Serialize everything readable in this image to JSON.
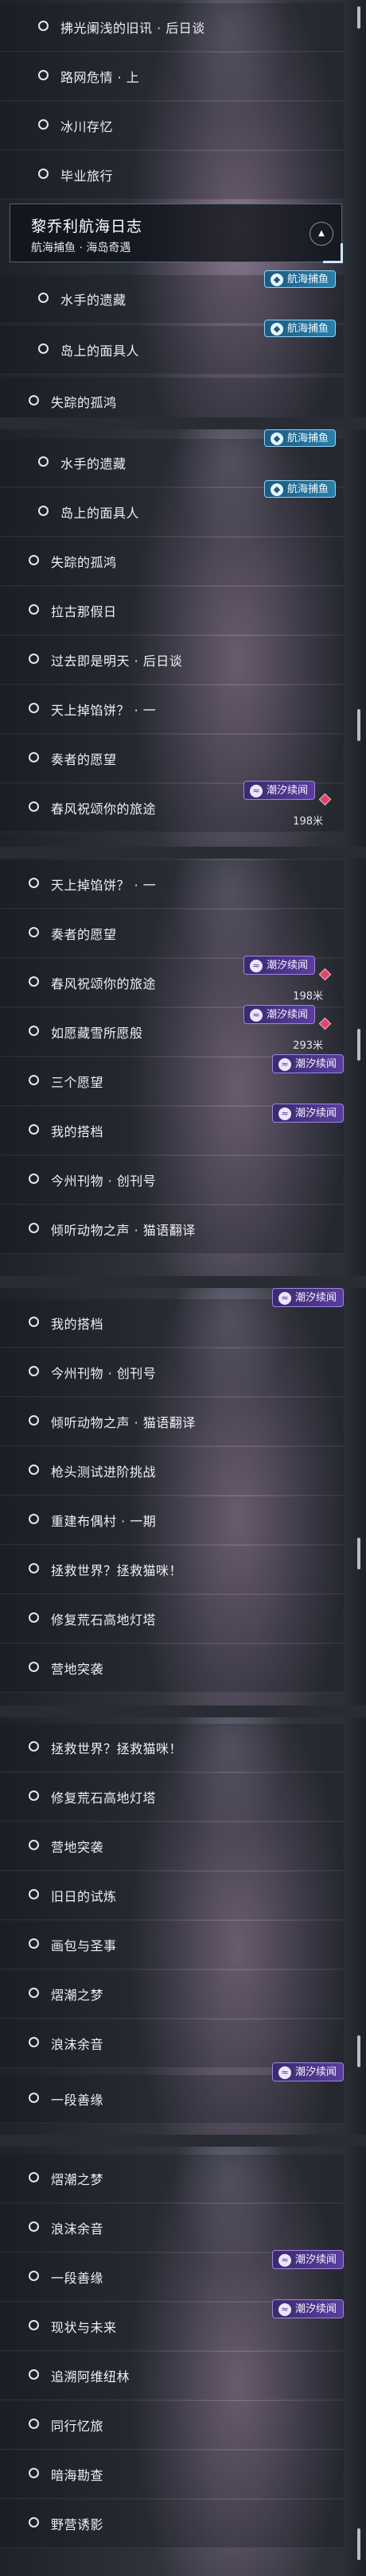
{
  "header": {
    "title": "黎乔利航海日志",
    "subtitle": "航海捕鱼 · 海岛奇遇",
    "collapse_icon": "▲"
  },
  "tags": {
    "chao": "潮汐续闻",
    "hang": "航海捕鱼"
  },
  "distances": {
    "chunfeng": "198米",
    "rubao": "293米"
  },
  "quests": {
    "fuguang": "拂光阑浅的旧讯 · 后日谈",
    "luwang": "路网危情 · 上",
    "bingchuan": "冰川存忆",
    "biye": "毕业旅行",
    "shuishou": "水手的遗藏",
    "daoshang": "岛上的面具人",
    "shizong": "失踪的孤鸿",
    "lagu": "拉古那假日",
    "guoqu": "过去即是明天 · 后日谈",
    "tianshang": "天上掉馅饼？ · 一",
    "zouzhe": "奏者的愿望",
    "chunfeng": "春风祝颂你的旅途",
    "rubao": "如愿藏雪所愿般",
    "sange": "三个愿望",
    "wode": "我的搭档",
    "jinzhou": "今州刊物 · 创刊号",
    "qingting": "倾听动物之声 · 猫语翻译",
    "qiangshou": "枪头测试进阶挑战",
    "chongjian": "重建布偶村 · 一期",
    "zhengjiu": "拯救世界？拯救猫咪！",
    "xiufu": "修复荒石高地灯塔",
    "yingdi": "营地突袭",
    "jiuri": "旧日的试炼",
    "huabi": "画包与圣事",
    "xichao": "熠潮之梦",
    "langmo": "浪沫余音",
    "yiduan": "一段善缘",
    "xianzhuang": "现状与未来",
    "zhuisu": "追溯阿维纽林",
    "tongxing": "同行忆旅",
    "anhai": "暗海勘查",
    "yeying": "野营诱影"
  }
}
